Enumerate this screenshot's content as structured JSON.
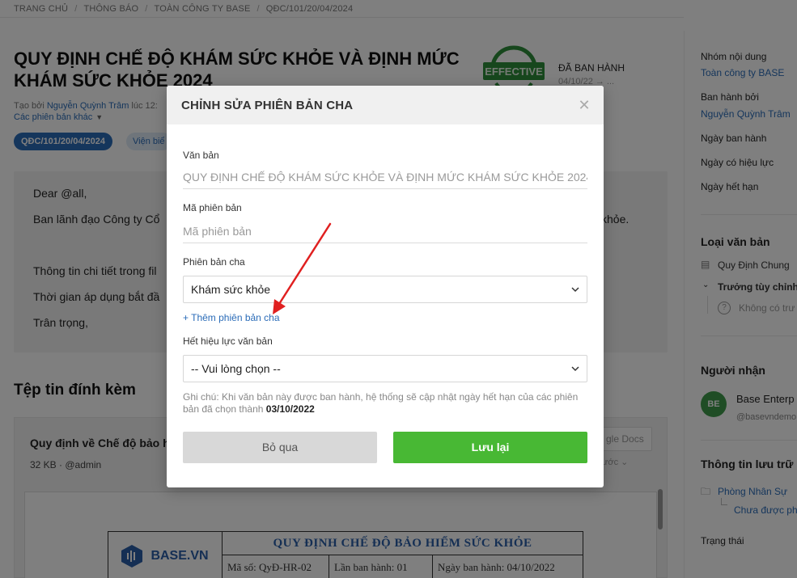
{
  "breadcrumb": [
    "TRANG CHỦ",
    "THÔNG BÁO",
    "TOÀN CÔNG TY BASE",
    "QĐC/101/20/04/2024"
  ],
  "document": {
    "title": "QUY ĐỊNH CHẾ ĐỘ KHÁM SỨC KHỎE VÀ ĐỊNH MỨC KHÁM SỨC KHỎE 2024",
    "created_by_prefix": "Tạo bởi",
    "author": "Nguyễn Quỳnh Trâm",
    "created_at": "lúc 12:",
    "other_versions": "Các phiên bản khác",
    "code_tag": "QĐC/101/20/04/2024",
    "type_tag": "Viện biể",
    "stamp_text": "EFFECTIVE",
    "status": "ĐÃ BAN HÀNH",
    "status_date": "04/10/22 → ...",
    "body_lines": [
      "Dear @all,",
      "Ban lãnh đạo Công ty Cổ",
      "Thông tin chi tiết trong fil",
      "Thời gian áp dụng bắt đầ",
      "Trân trọng,"
    ],
    "body_trail": "khỏe."
  },
  "attachments": {
    "heading": "Tệp tin đính kèm",
    "file_name": "Quy định về Chế độ bảo h",
    "file_meta": "32 KB · @admin",
    "gdocs_label": "gle Docs",
    "prev_label": "ước",
    "preview": {
      "logo_text": "BASE.VN",
      "heading": "QUY ĐỊNH CHẾ ĐỘ BẢO HIỂM SỨC KHỎE",
      "cells": [
        "Mã số: QyĐ-HR-02",
        "Lần ban hành: 01",
        "Ngày ban hành: 04/10/2022"
      ]
    }
  },
  "right_panel": {
    "group_label": "Nhóm nội dung",
    "group_value": "Toàn công ty BASE",
    "issued_by_label": "Ban hành bởi",
    "issued_by_value": "Nguyễn Quỳnh Trâm",
    "issue_date_label": "Ngày ban hành",
    "effective_date_label": "Ngày có hiệu lực",
    "expiry_date_label": "Ngày hết hạn",
    "doc_type_heading": "Loại văn bản",
    "doc_type_1": "Quy Định Chung",
    "doc_type_2": "Trưởng tùy chỉnh",
    "doc_type_3": "Không có trư",
    "recipient_heading": "Người nhận",
    "recipient_initials": "BE",
    "recipient_name": "Base Enterp",
    "recipient_handle": "@basevndemo",
    "storage_heading": "Thông tin lưu trữ",
    "storage_folder": "Phòng Nhân Sự",
    "storage_sub": "Chưa được ph",
    "status_label": "Trạng thái"
  },
  "modal": {
    "title": "CHỈNH SỬA PHIÊN BẢN CHA",
    "close_icon": "close-icon",
    "document_label": "Văn bản",
    "document_value": "QUY ĐỊNH CHẾ ĐỘ KHÁM SỨC KHỎE VÀ ĐỊNH MỨC KHÁM SỨC KHỎE 2024",
    "version_code_label": "Mã phiên bản",
    "version_code_placeholder": "Mã phiên bản",
    "parent_version_label": "Phiên bản cha",
    "parent_version_value": "Khám sức khỏe",
    "add_parent_link": "+ Thêm phiên bản cha",
    "expire_label": "Hết hiệu lực văn bản",
    "expire_value": "-- Vui lòng chọn --",
    "note_text": "Ghi chú: Khi văn bản này được ban hành, hệ thống sẽ cập nhật ngày hết hạn của các phiên bản đã chọn thành",
    "note_date": "03/10/2022",
    "skip_button": "Bỏ qua",
    "save_button": "Lưu lại"
  },
  "colors": {
    "accent_blue": "#2b6cb8",
    "save_green": "#48b834",
    "arrow_red": "#e02020"
  }
}
